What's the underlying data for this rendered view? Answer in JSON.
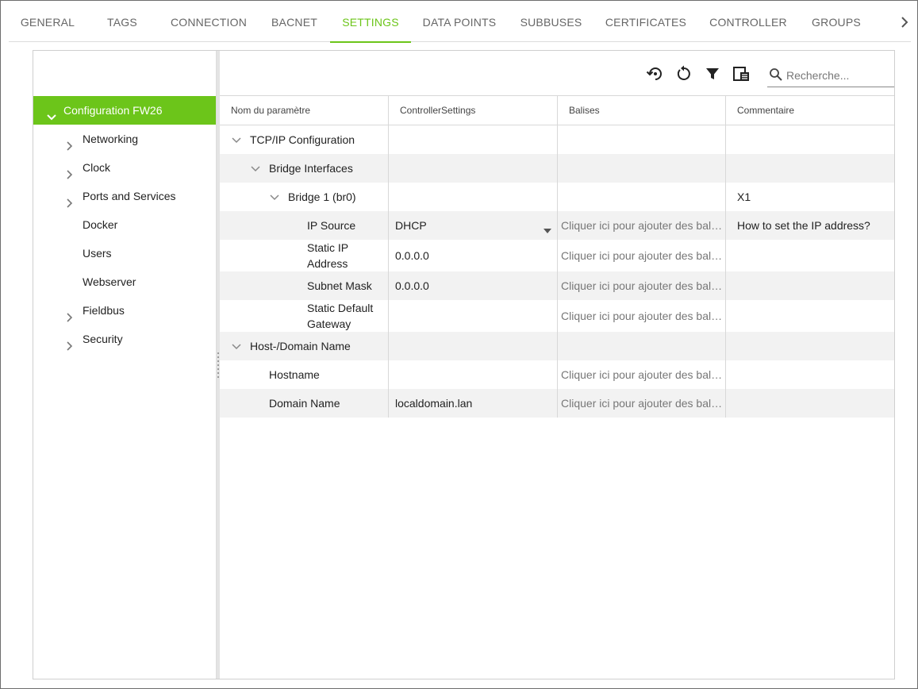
{
  "tabs": [
    {
      "label": "GENERAL",
      "active": false
    },
    {
      "label": "TAGS",
      "active": false
    },
    {
      "label": "CONNECTION",
      "active": false
    },
    {
      "label": "BACNET",
      "active": false
    },
    {
      "label": "SETTINGS",
      "active": true
    },
    {
      "label": "DATA POINTS",
      "active": false
    },
    {
      "label": "SUBBUSES",
      "active": false
    },
    {
      "label": "CERTIFICATES",
      "active": false
    },
    {
      "label": "CONTROLLER",
      "active": false
    },
    {
      "label": "GROUPS",
      "active": false
    }
  ],
  "icons": {
    "tab_next": "chevron-right-icon",
    "restore": "restore-history-icon",
    "reset": "reset-icon",
    "filter": "filter-icon",
    "columns": "columns-panel-icon",
    "search": "search-icon"
  },
  "accent_color": "#6cc51a",
  "sidebar": {
    "root": {
      "label": "Configuration FW26",
      "expanded": true
    },
    "items": [
      {
        "label": "Networking",
        "expandable": true
      },
      {
        "label": "Clock",
        "expandable": true
      },
      {
        "label": "Ports and Services",
        "expandable": true
      },
      {
        "label": "Docker",
        "expandable": false
      },
      {
        "label": "Users",
        "expandable": false
      },
      {
        "label": "Webserver",
        "expandable": false
      },
      {
        "label": "Fieldbus",
        "expandable": true
      },
      {
        "label": "Security",
        "expandable": true
      }
    ]
  },
  "search": {
    "placeholder": "Recherche..."
  },
  "grid": {
    "columns": [
      "Nom du paramètre",
      "ControllerSettings",
      "Balises",
      "Commentaire"
    ],
    "rows": [
      {
        "name": "TCP/IP Configuration",
        "value": "",
        "tags": "",
        "comment": ""
      },
      {
        "name": "Bridge Interfaces",
        "value": "",
        "tags": "",
        "comment": ""
      },
      {
        "name": "Bridge 1 (br0)",
        "value": "",
        "tags": "",
        "comment": "X1"
      },
      {
        "name": "IP Source",
        "value": "DHCP",
        "tags": "Cliquer ici pour ajouter des balises",
        "comment": "How to set the IP address?"
      },
      {
        "name_lines": [
          "Static IP",
          "Address"
        ],
        "value": "0.0.0.0",
        "tags": "Cliquer ici pour ajouter des balises",
        "comment": ""
      },
      {
        "name": "Subnet Mask",
        "value": "0.0.0.0",
        "tags": "Cliquer ici pour ajouter des balises",
        "comment": ""
      },
      {
        "name_lines": [
          "Static Default",
          "Gateway"
        ],
        "value": "",
        "tags": "Cliquer ici pour ajouter des balises",
        "comment": ""
      },
      {
        "name": "Host-/Domain Name",
        "value": "",
        "tags": "",
        "comment": ""
      },
      {
        "name": "Hostname",
        "value": "",
        "tags": "Cliquer ici pour ajouter des balises",
        "comment": ""
      },
      {
        "name": "Domain Name",
        "value": "localdomain.lan",
        "tags": "Cliquer ici pour ajouter des balises",
        "comment": ""
      }
    ]
  }
}
